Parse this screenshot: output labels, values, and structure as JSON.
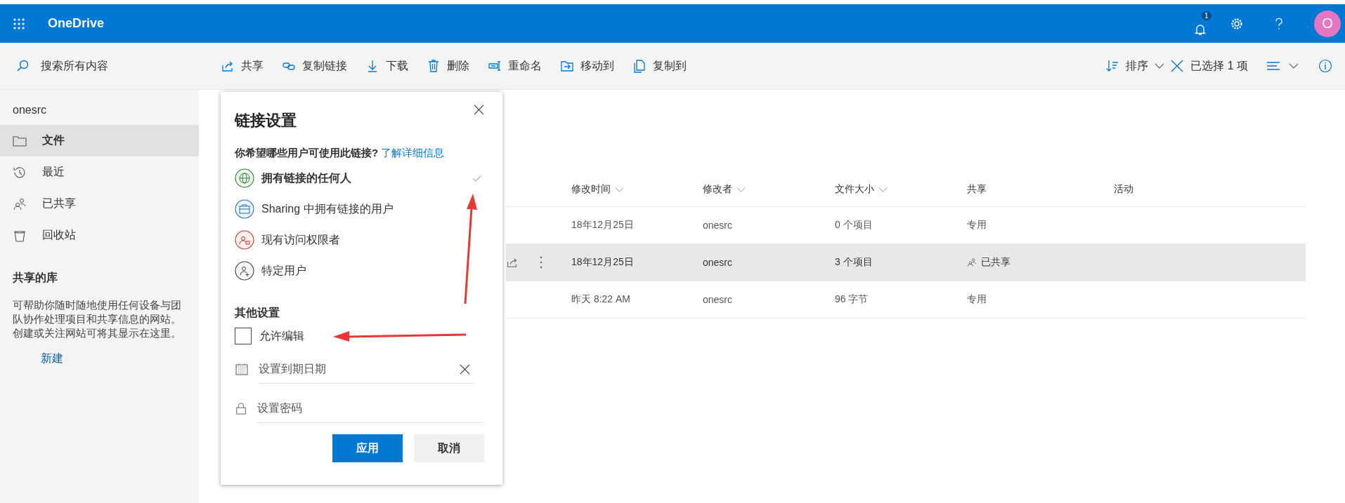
{
  "header": {
    "app_title": "OneDrive",
    "notification_count": "1",
    "avatar_initial": "O"
  },
  "toolbar": {
    "search_placeholder": "搜索所有内容",
    "actions": [
      {
        "kind": "share",
        "label": "共享"
      },
      {
        "kind": "link",
        "label": "复制链接"
      },
      {
        "kind": "download",
        "label": "下载"
      },
      {
        "kind": "delete",
        "label": "删除"
      },
      {
        "kind": "rename",
        "label": "重命名"
      },
      {
        "kind": "move",
        "label": "移动到"
      },
      {
        "kind": "copy",
        "label": "复制到"
      }
    ],
    "sort_label": "排序",
    "selection_label": "已选择 1 项"
  },
  "sidebar": {
    "account": "onesrc",
    "nav": [
      {
        "kind": "folder",
        "label": "文件",
        "selected": true
      },
      {
        "kind": "recent",
        "label": "最近",
        "selected": false
      },
      {
        "kind": "shared",
        "label": "已共享",
        "selected": false
      },
      {
        "kind": "bin",
        "label": "回收站",
        "selected": false
      }
    ],
    "section_title": "共享的库",
    "description": "可帮助你随时随地使用任何设备与团队协作处理项目和共享信息的网站。创建或关注网站可将其显示在这里。",
    "new_link": "新建"
  },
  "table": {
    "columns": [
      {
        "label": "修改时间",
        "sortable": true
      },
      {
        "label": "修改者",
        "sortable": true
      },
      {
        "label": "文件大小",
        "sortable": true
      },
      {
        "label": "共享",
        "sortable": false
      },
      {
        "label": "活动",
        "sortable": false
      }
    ],
    "rows": [
      {
        "selected": false,
        "modified": "18年12月25日",
        "modified_by": "onesrc",
        "size": "0 个项目",
        "sharing": "专用",
        "shared": false
      },
      {
        "selected": true,
        "modified": "18年12月25日",
        "modified_by": "onesrc",
        "size": "3 个项目",
        "sharing": "已共享",
        "shared": true
      },
      {
        "selected": false,
        "modified": "昨天 8:22 AM",
        "modified_by": "onesrc",
        "size": "96 字节",
        "sharing": "专用",
        "shared": false
      }
    ]
  },
  "dialog": {
    "title": "链接设置",
    "question": "你希望哪些用户可使用此链接?",
    "learn_more": "了解详细信息",
    "options": [
      {
        "kind": "anyone",
        "label": "拥有链接的任何人",
        "selected": true
      },
      {
        "kind": "org",
        "label": "Sharing 中拥有链接的用户",
        "selected": false
      },
      {
        "kind": "existing",
        "label": "现有访问权限者",
        "selected": false
      },
      {
        "kind": "specific",
        "label": "特定用户",
        "selected": false
      }
    ],
    "other_title": "其他设置",
    "allow_edit": {
      "label": "允许编辑",
      "checked": false
    },
    "expiry_placeholder": "设置到期日期",
    "password_placeholder": "设置密码",
    "apply_label": "应用",
    "cancel_label": "取消"
  }
}
